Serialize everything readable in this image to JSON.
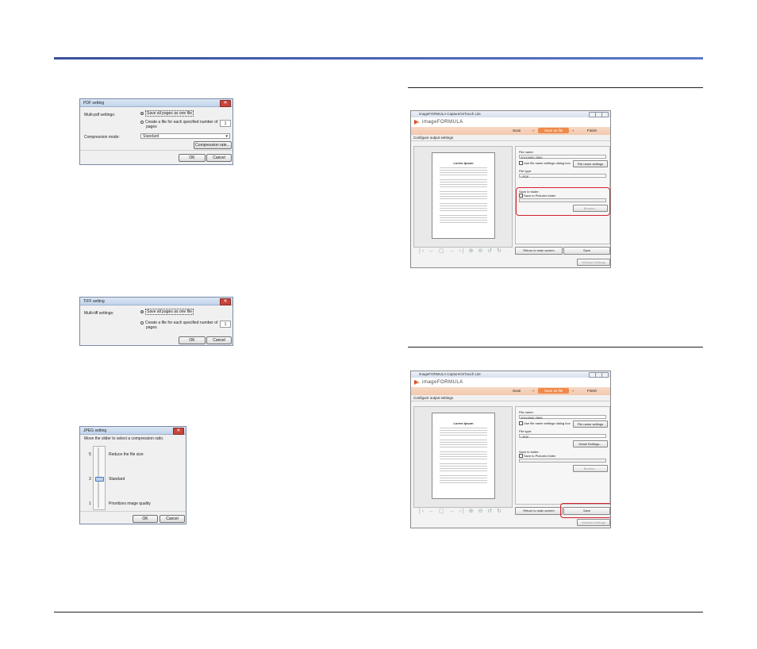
{
  "pdf_dialog": {
    "title": "PDF setting",
    "multipdf_label": "Multi-pdf settings:",
    "option_one_file": "Save all pages as one file",
    "option_each_pages_1": "Create a file for each specified number of",
    "option_each_pages_2": "pages",
    "pages_value": "1",
    "compression_label": "Compression mode:",
    "compression_value": "Standard",
    "compression_rate_button": "Compression rate...",
    "ok": "OK",
    "cancel": "Cancel"
  },
  "tiff_dialog": {
    "title": "TIFF setting",
    "multitiff_label": "Multi-tiff settings:",
    "option_one_file": "Save all pages as one file",
    "option_each_pages_1": "Create a file for each specified number of",
    "option_each_pages_2": "pages",
    "pages_value": "1",
    "ok": "OK",
    "cancel": "Cancel"
  },
  "jpeg_dialog": {
    "title": "JPEG setting",
    "instruction": "Move the slider to select a compression ratio.",
    "level_top": "5",
    "level_mid": "3",
    "level_bottom": "1",
    "label_top": "Reduce the file size",
    "label_mid": "Standard",
    "label_bottom": "Prioritizes image quality",
    "slider_level": 3,
    "ok": "OK",
    "cancel": "Cancel"
  },
  "app_window_1": {
    "title": "imageFORMULA CaptureOnTouch Lite",
    "brand": "imageFORMULA",
    "steps": [
      "Scan",
      "Save as file",
      "Finish"
    ],
    "section": "Configure output settings",
    "page_title": "Lorem Ipsum",
    "file_name_label": "File name:",
    "file_name_value": "20110000 2500",
    "use_dialog_label": "Use file name settings dialog box",
    "file_name_settings": "File name settings",
    "file_type_label": "File type:",
    "file_type_value": "PDF",
    "save_in_label": "Save in folder:",
    "save_in_value": "Save to Pictures folder",
    "browse": "Browse...",
    "return": "Return to main screen",
    "save": "Save",
    "window_settings": "Window Settings"
  },
  "app_window_2": {
    "title": "imageFORMULA CaptureOnTouch Lite",
    "brand": "imageFORMULA",
    "steps": [
      "Scan",
      "Save as file",
      "Finish"
    ],
    "section": "Configure output settings",
    "page_title": "Lorem Ipsum",
    "file_name_label": "File name:",
    "file_name_value": "20110000 2500",
    "use_dialog_label": "Use file name settings dialog box",
    "file_name_settings": "File name settings",
    "file_type_label": "File type:",
    "file_type_value": "PDF",
    "detail_settings": "Detail Settings...",
    "save_in_label": "Save in folder:",
    "save_in_value": "Save to Pictures folder",
    "browse": "Browse...",
    "return": "Return to main screen",
    "save": "Save",
    "window_settings": "Window Settings"
  },
  "colors": {
    "header_rule": "#3a4f9a",
    "highlight": "#d2232a",
    "step_active": "#ef8a4a"
  }
}
